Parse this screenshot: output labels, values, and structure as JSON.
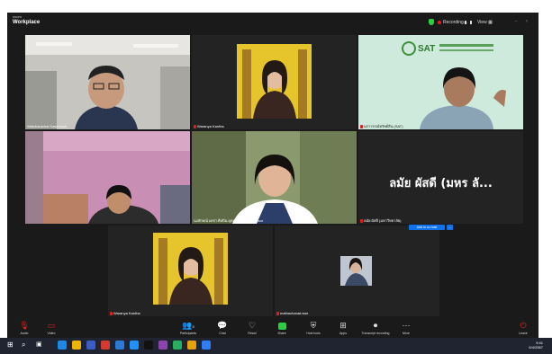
{
  "app": {
    "brand_small": "zoom",
    "brand_large": "Workplace"
  },
  "topbar": {
    "recording_label": "Recording...",
    "view_label": "View",
    "colors": {
      "recording": "#e02020",
      "shield": "#2ecc40"
    }
  },
  "tiles": [
    {
      "name": "Watcharachai Kasemsuk"
    },
    {
      "name": "Waranya Kantha"
    },
    {
      "name": "นราวรรณ์ทรัพย์สิน (SAT)"
    },
    {
      "name": ""
    },
    {
      "name": "นงลักษณ์ เดชา ศิลปิน อุดมสินทักษ์ Professor"
    },
    {
      "name": "ลมัย ผัสดี (มหาวิทยาลัย)",
      "big_name": "ลมัย ผัสดี (มหร ลั..."
    },
    {
      "name": "Waranya Kantha"
    },
    {
      "name": "mathachanat.wse"
    }
  ],
  "popup": {
    "add_cohost": "Add to co-host",
    "more": "..."
  },
  "toolbar": {
    "audio": "Audio",
    "video": "Video",
    "participants": "Participants",
    "participants_count": "8",
    "chat": "Chat",
    "react": "React",
    "share": "Share",
    "host_tools": "Host tools",
    "apps": "Apps",
    "transcript": "Transcript recording",
    "more": "More",
    "leave": "Leave"
  },
  "taskbar": {
    "time": "9:41",
    "date": "6/4/2567"
  },
  "colors": {
    "accent": "#0e72ed",
    "muted": "#e02020",
    "share": "#2ecc40"
  }
}
